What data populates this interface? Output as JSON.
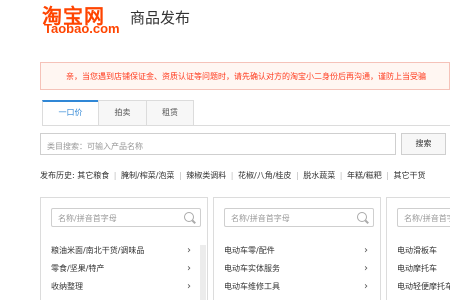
{
  "header": {
    "logo_cn": "淘宝网",
    "logo_en": "Taobao.com",
    "title": "商品发布"
  },
  "notice": {
    "text": "亲，当您遇到店铺保证金、资质认证等问题时，请先确认对方的淘宝小二身份后再沟通，谨防上当受骗"
  },
  "tabs": [
    {
      "label": "一口价",
      "active": true
    },
    {
      "label": "拍卖",
      "active": false
    },
    {
      "label": "租赁",
      "active": false
    }
  ],
  "search": {
    "placeholder": "类目搜索：可输入产品名称",
    "button_label": "搜索"
  },
  "history": {
    "label": "发布历史:",
    "items": [
      "其它粮食",
      "腌制/榨菜/泡菜",
      "辣椒类调料",
      "花椒/八角/桂皮",
      "脱水蔬菜",
      "年糕/糍粑",
      "其它干货"
    ]
  },
  "panels": [
    {
      "placeholder": "名称/拼音首字母",
      "items": [
        "粮油米面/南北干货/调味品",
        "零食/坚果/特产",
        "收纳整理"
      ]
    },
    {
      "placeholder": "名称/拼音首字母",
      "items": [
        "电动车零/配件",
        "电动车实体服务",
        "电动车维修工具"
      ]
    },
    {
      "placeholder": "名称/拼音首字母",
      "items": [
        "电动滑板车",
        "电动摩托车",
        "电动轻便摩托车"
      ]
    }
  ],
  "colors": {
    "brand": "#ff4400",
    "notice_text": "#ff3b1e",
    "tab_active": "#3087d6"
  }
}
